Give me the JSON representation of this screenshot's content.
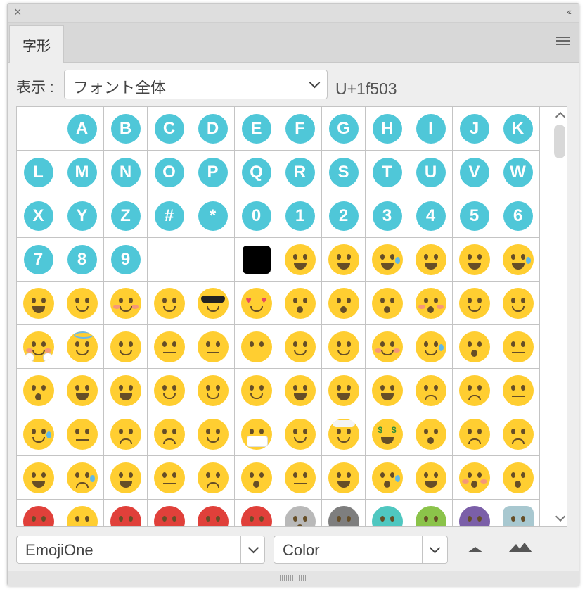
{
  "window": {
    "close_label": "×",
    "collapse_label": "‹‹"
  },
  "tab": {
    "label": "字形"
  },
  "toolbar": {
    "show_label": "表示 :",
    "show_value": "フォント全体",
    "unicode": "U+1f503"
  },
  "footer": {
    "font_family": "EmojiOne",
    "font_style": "Color"
  },
  "glyphs": {
    "keycaps": [
      "A",
      "B",
      "C",
      "D",
      "E",
      "F",
      "G",
      "H",
      "I",
      "J",
      "K",
      "L",
      "M",
      "N",
      "O",
      "P",
      "Q",
      "R",
      "S",
      "T",
      "U",
      "V",
      "W",
      "X",
      "Y",
      "Z",
      "#",
      "*",
      "0",
      "1",
      "2",
      "3",
      "4",
      "5",
      "6",
      "7",
      "8",
      "9"
    ]
  },
  "colors": {
    "keycap": "#4fc7d8",
    "emoji_face": "#ffce31",
    "emoji_feature": "#664e27"
  },
  "icons": [
    "close-icon",
    "collapse-icon",
    "panel-menu-icon",
    "chevron-down-icon",
    "scroll-up-icon",
    "scroll-down-icon",
    "size-small-icon",
    "size-large-icon"
  ]
}
